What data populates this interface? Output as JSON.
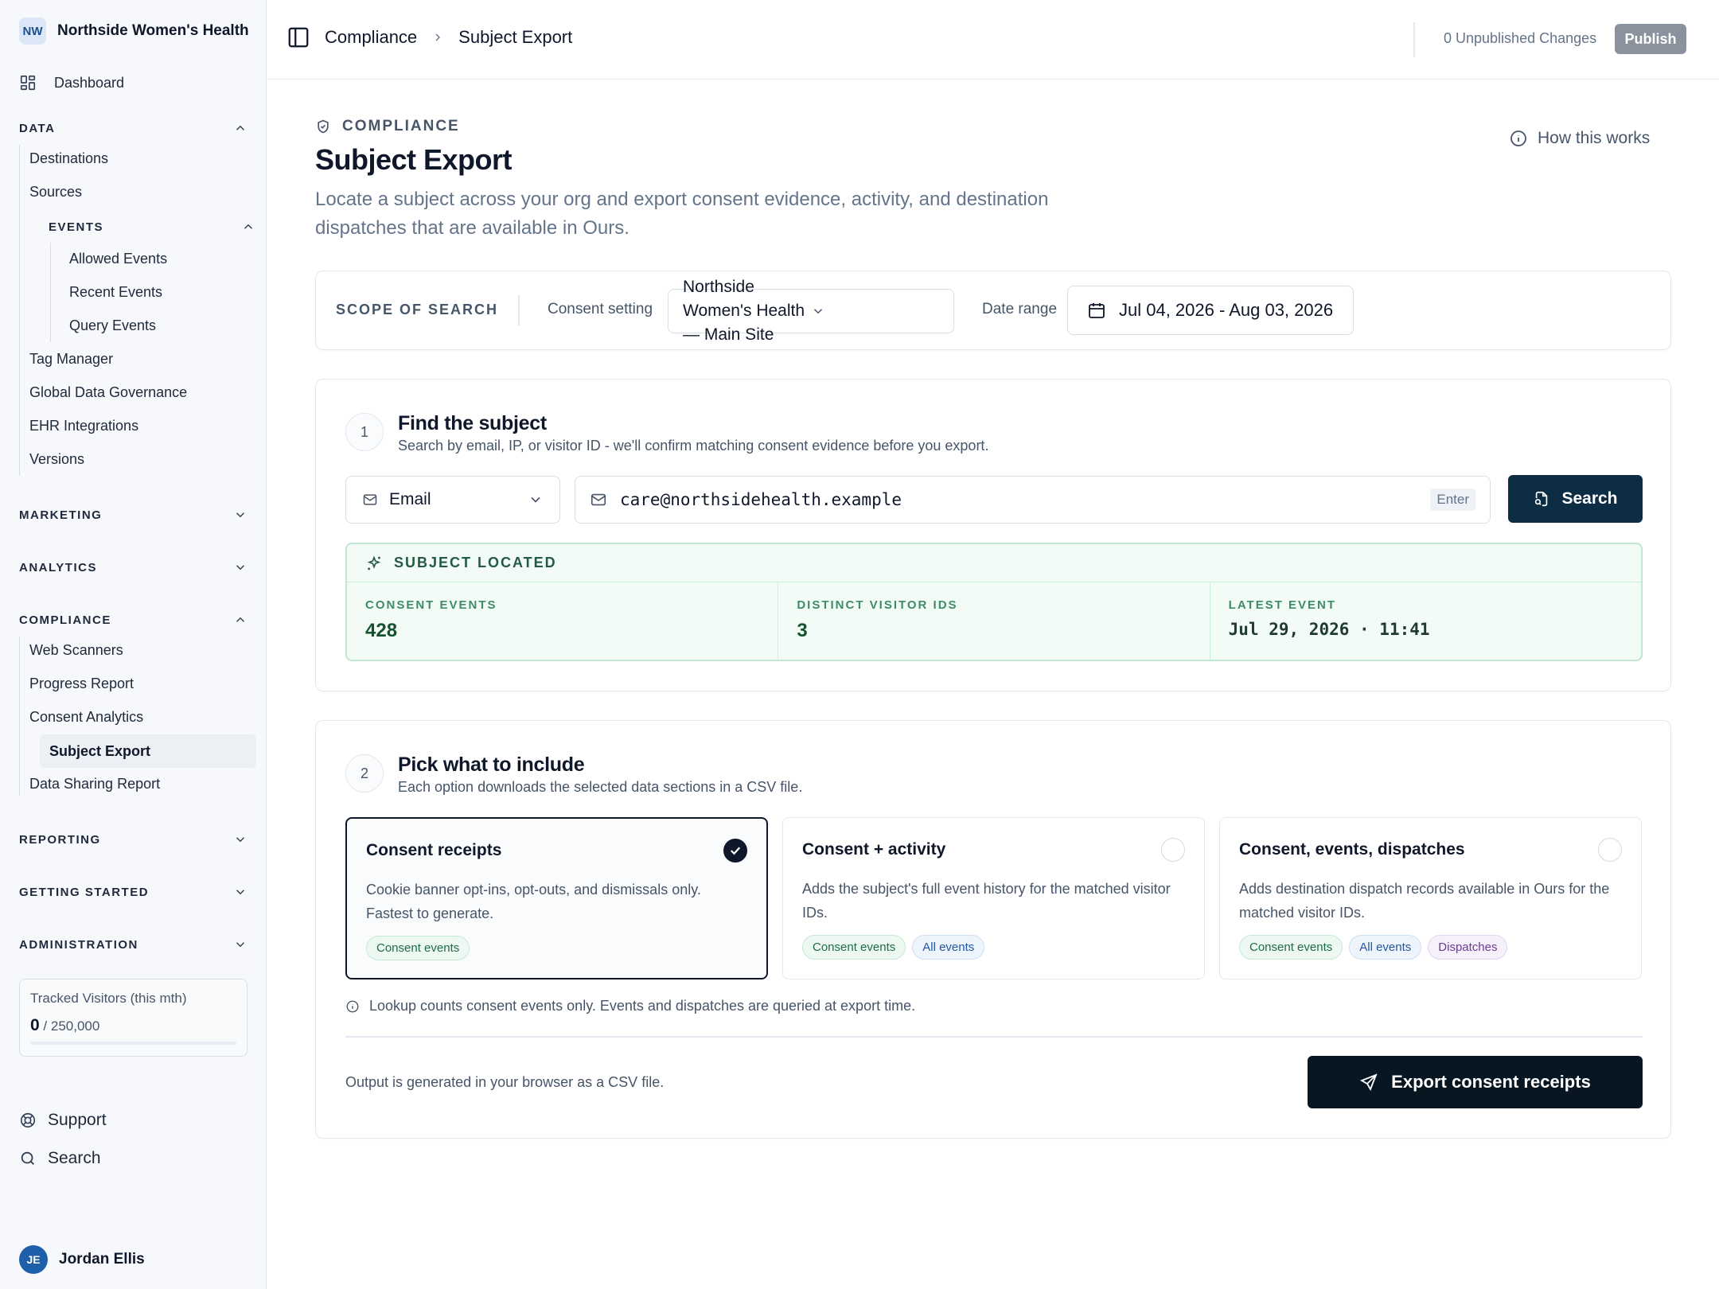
{
  "org": {
    "initials": "NW",
    "name": "Northside Women's Health"
  },
  "sidebar": {
    "dashboard": "Dashboard",
    "sections": {
      "data": "DATA",
      "marketing": "MARKETING",
      "analytics": "ANALYTICS",
      "compliance": "COMPLIANCE",
      "reporting": "REPORTING",
      "getting_started": "GETTING STARTED",
      "administration": "ADMINISTRATION"
    },
    "data_items": [
      "Destinations",
      "Sources"
    ],
    "events_head": "EVENTS",
    "events_items": [
      "Allowed Events",
      "Recent Events",
      "Query Events"
    ],
    "data_items_after": [
      "Tag Manager",
      "Global Data Governance",
      "EHR Integrations",
      "Versions"
    ],
    "compliance_items": [
      "Web Scanners",
      "Progress Report",
      "Consent Analytics",
      "Subject Export",
      "Data Sharing Report"
    ],
    "active_item": "Subject Export",
    "visitors": {
      "label": "Tracked Visitors (this mth)",
      "value": "0",
      "limit": "/ 250,000",
      "usage_fraction": 0
    },
    "support": "Support",
    "search": "Search",
    "user": {
      "initials": "JE",
      "name": "Jordan Ellis"
    }
  },
  "topbar": {
    "breadcrumb_parent": "Compliance",
    "breadcrumb_current": "Subject Export",
    "unpublished": "0 Unpublished Changes",
    "publish": "Publish"
  },
  "header": {
    "eyebrow": "COMPLIANCE",
    "title": "Subject Export",
    "subtitle": "Locate a subject across your org and export consent evidence, activity, and destination dispatches that are available in Ours.",
    "how_link": "How this works"
  },
  "scope": {
    "title": "SCOPE OF SEARCH",
    "consent_label": "Consent setting",
    "consent_value": "Northside Women's Health — Main Site",
    "date_label": "Date range",
    "date_value": "Jul 04, 2026 - Aug 03, 2026"
  },
  "find": {
    "step": "1",
    "title": "Find the subject",
    "subtitle": "Search by email, IP, or visitor ID - we'll confirm matching consent evidence before you export.",
    "type_value": "Email",
    "query_value": "care@northsidehealth.example",
    "enter_hint": "Enter",
    "search_button": "Search",
    "located_title": "SUBJECT LOCATED",
    "stats": [
      {
        "label": "CONSENT EVENTS",
        "value": "428"
      },
      {
        "label": "DISTINCT VISITOR IDS",
        "value": "3"
      },
      {
        "label": "LATEST EVENT",
        "value": "Jul 29, 2026 · 11:41"
      }
    ]
  },
  "pick": {
    "step": "2",
    "title": "Pick what to include",
    "subtitle": "Each option downloads the selected data sections in a CSV file.",
    "options": [
      {
        "title": "Consent receipts",
        "desc": "Cookie banner opt-ins, opt-outs, and dismissals only. Fastest to generate.",
        "tags": [
          "Consent events"
        ],
        "selected": true
      },
      {
        "title": "Consent + activity",
        "desc": "Adds the subject's full event history for the matched visitor IDs.",
        "tags": [
          "Consent events",
          "All events"
        ],
        "selected": false
      },
      {
        "title": "Consent, events, dispatches",
        "desc": "Adds destination dispatch records available in Ours for the matched visitor IDs.",
        "tags": [
          "Consent events",
          "All events",
          "Dispatches"
        ],
        "selected": false
      }
    ],
    "note": "Lookup counts consent events only. Events and dispatches are queried at export time.",
    "footnote": "Output is generated in your browser as a CSV file.",
    "export_button": "Export consent receipts"
  }
}
